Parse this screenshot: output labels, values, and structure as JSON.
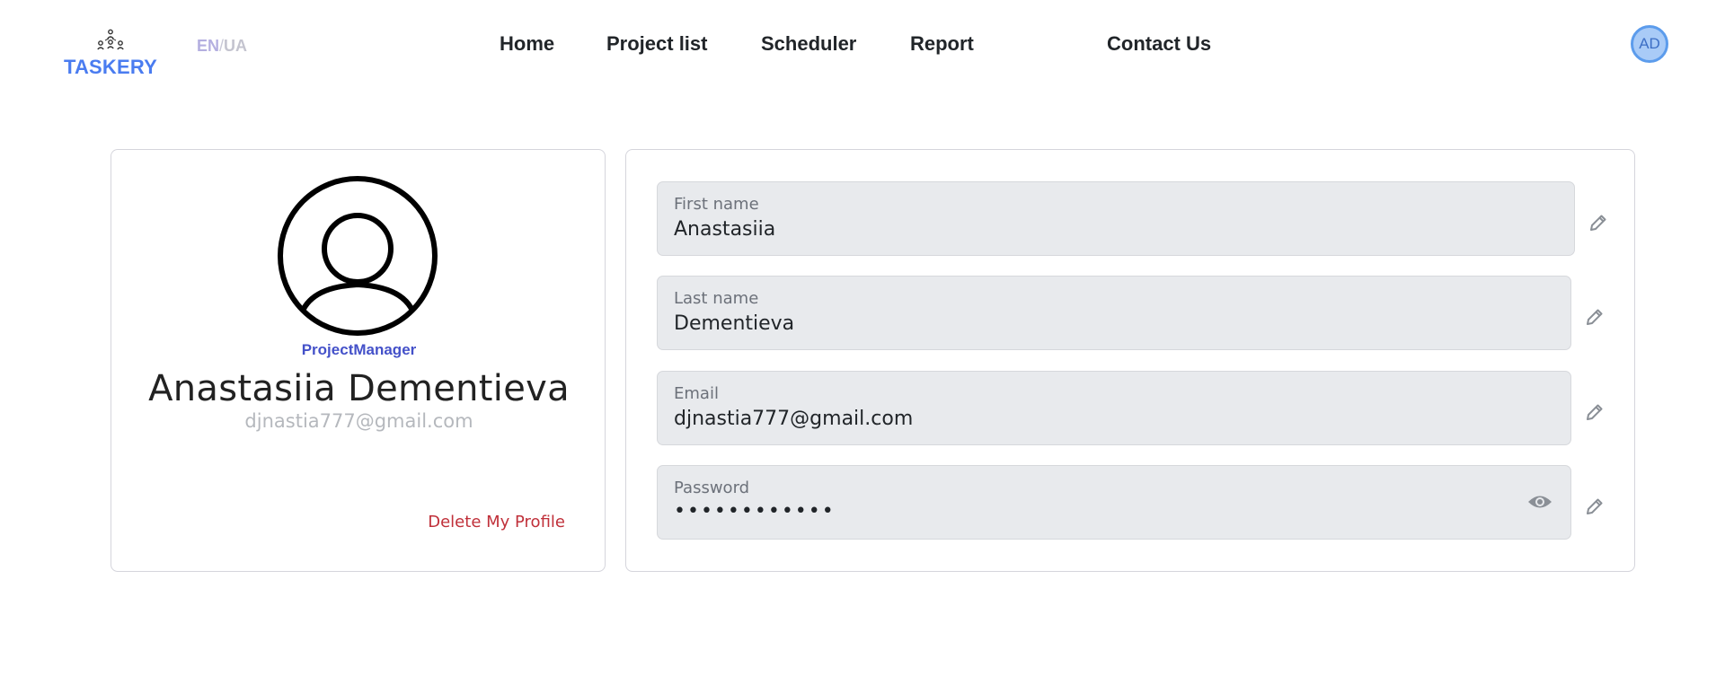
{
  "header": {
    "logo_text": "TASKERY",
    "lang": {
      "en": "EN",
      "separator": "/",
      "ua": "UA"
    },
    "nav": [
      {
        "label": "Home"
      },
      {
        "label": "Project list"
      },
      {
        "label": "Scheduler"
      },
      {
        "label": "Report"
      },
      {
        "label": "Contact Us"
      }
    ],
    "avatar_initials": "AD"
  },
  "profile": {
    "role": "ProjectManager",
    "full_name": "Anastasiia Dementieva",
    "email": "djnastia777@gmail.com",
    "delete_label": "Delete My Profile"
  },
  "form": {
    "first_name": {
      "label": "First name",
      "value": "Anastasiia"
    },
    "last_name": {
      "label": "Last name",
      "value": "Dementieva"
    },
    "email": {
      "label": "Email",
      "value": "djnastia777@gmail.com"
    },
    "password": {
      "label": "Password",
      "value": "••••••••••••"
    }
  },
  "icons": {
    "edit": "pencil-icon",
    "show_password": "eye-icon",
    "profile_photo": "user-circle-icon",
    "logo": "team-hierarchy-icon"
  },
  "colors": {
    "brand": "#4a7cf0",
    "role": "#4451c9",
    "danger": "#c0303a",
    "field_bg": "#e8eaed",
    "avatar_bg": "#a9cbf7"
  }
}
